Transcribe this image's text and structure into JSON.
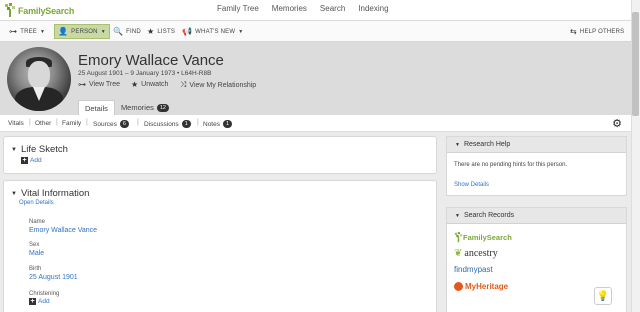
{
  "brand": {
    "name": "FamilySearch",
    "green": "#7aa83a",
    "link": "#3174c4"
  },
  "topnav": [
    "Family Tree",
    "Memories",
    "Search",
    "Indexing"
  ],
  "toolbar": {
    "tree": "TREE",
    "person": "PERSON",
    "find": "FIND",
    "lists": "LISTS",
    "whats_new": "WHAT'S NEW",
    "help_others": "HELP OTHERS"
  },
  "person": {
    "name": "Emory Wallace Vance",
    "dates": "25 August 1901 – 9 January 1973 • L64H-R8B",
    "actions": {
      "view_tree": "View Tree",
      "unwatch": "Unwatch",
      "view_relationship": "View My Relationship"
    },
    "tabs": {
      "details": "Details",
      "memories": "Memories",
      "memories_count": "12"
    }
  },
  "subtabs": {
    "vitals": "Vitals",
    "other": "Other",
    "family": "Family",
    "sources": "Sources",
    "sources_count": "6",
    "discussions": "Discussions",
    "discussions_count": "1",
    "notes": "Notes",
    "notes_count": "1"
  },
  "life_sketch": {
    "title": "Life Sketch",
    "add": "Add"
  },
  "vital_info": {
    "title": "Vital Information",
    "open_details": "Open Details",
    "name_label": "Name",
    "name_value": "Emory Wallace Vance",
    "sex_label": "Sex",
    "sex_value": "Male",
    "birth_label": "Birth",
    "birth_value": "25 August 1901",
    "christening_label": "Christening",
    "add": "Add"
  },
  "research_help": {
    "title": "Research Help",
    "text": "There are no pending hints for this person.",
    "link": "Show Details"
  },
  "search_records": {
    "title": "Search Records",
    "partners": [
      "FamilySearch",
      "ancestry",
      "findmypast",
      "MyHeritage"
    ]
  }
}
